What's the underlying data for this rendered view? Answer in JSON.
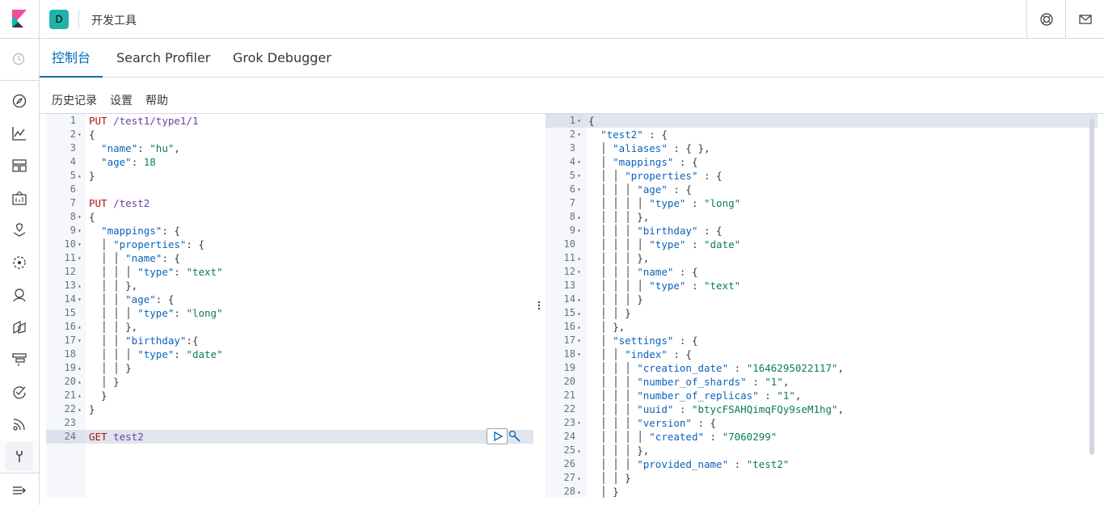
{
  "header": {
    "space_initial": "D",
    "app_title": "开发工具"
  },
  "tabs": [
    {
      "label": "控制台"
    },
    {
      "label": "Search Profiler"
    },
    {
      "label": "Grok Debugger"
    }
  ],
  "toolbar": {
    "history": "历史记录",
    "settings": "设置",
    "help": "帮助"
  },
  "request_editor": {
    "lines": [
      {
        "n": "1",
        "fold": "",
        "tokens": [
          [
            "k",
            "PUT"
          ],
          [
            "o",
            " "
          ],
          [
            "p",
            "/test1/type1/1"
          ]
        ]
      },
      {
        "n": "2",
        "fold": "▾",
        "tokens": [
          [
            "o",
            "{"
          ]
        ]
      },
      {
        "n": "3",
        "fold": "",
        "tokens": [
          [
            "o",
            "  "
          ],
          [
            "kk",
            "\"name\""
          ],
          [
            "o",
            ": "
          ],
          [
            "s",
            "\"hu\""
          ],
          [
            "o",
            ","
          ]
        ]
      },
      {
        "n": "4",
        "fold": "",
        "tokens": [
          [
            "o",
            "  "
          ],
          [
            "kk",
            "\"age\""
          ],
          [
            "o",
            ": "
          ],
          [
            "n",
            "18"
          ]
        ]
      },
      {
        "n": "5",
        "fold": "▴",
        "tokens": [
          [
            "o",
            "}"
          ]
        ]
      },
      {
        "n": "6",
        "fold": "",
        "tokens": []
      },
      {
        "n": "7",
        "fold": "",
        "tokens": [
          [
            "k",
            "PUT"
          ],
          [
            "o",
            " "
          ],
          [
            "p",
            "/test2"
          ]
        ]
      },
      {
        "n": "8",
        "fold": "▾",
        "tokens": [
          [
            "o",
            "{"
          ]
        ]
      },
      {
        "n": "9",
        "fold": "▾",
        "tokens": [
          [
            "o",
            "  "
          ],
          [
            "kk",
            "\"mappings\""
          ],
          [
            "o",
            ": {"
          ]
        ]
      },
      {
        "n": "10",
        "fold": "▾",
        "tokens": [
          [
            "o",
            "  │ "
          ],
          [
            "kk",
            "\"properties\""
          ],
          [
            "o",
            ": {"
          ]
        ]
      },
      {
        "n": "11",
        "fold": "▾",
        "tokens": [
          [
            "o",
            "  │ │ "
          ],
          [
            "kk",
            "\"name\""
          ],
          [
            "o",
            ": {"
          ]
        ]
      },
      {
        "n": "12",
        "fold": "",
        "tokens": [
          [
            "o",
            "  │ │ │ "
          ],
          [
            "kk",
            "\"type\""
          ],
          [
            "o",
            ": "
          ],
          [
            "s",
            "\"text\""
          ]
        ]
      },
      {
        "n": "13",
        "fold": "▴",
        "tokens": [
          [
            "o",
            "  │ │ },"
          ]
        ]
      },
      {
        "n": "14",
        "fold": "▾",
        "tokens": [
          [
            "o",
            "  │ │ "
          ],
          [
            "kk",
            "\"age\""
          ],
          [
            "o",
            ": {"
          ]
        ]
      },
      {
        "n": "15",
        "fold": "",
        "tokens": [
          [
            "o",
            "  │ │ │ "
          ],
          [
            "kk",
            "\"type\""
          ],
          [
            "o",
            ": "
          ],
          [
            "s",
            "\"long\""
          ]
        ]
      },
      {
        "n": "16",
        "fold": "▴",
        "tokens": [
          [
            "o",
            "  │ │ },"
          ]
        ]
      },
      {
        "n": "17",
        "fold": "▾",
        "tokens": [
          [
            "o",
            "  │ │ "
          ],
          [
            "kk",
            "\"birthday\""
          ],
          [
            "o",
            ":{"
          ]
        ]
      },
      {
        "n": "18",
        "fold": "",
        "tokens": [
          [
            "o",
            "  │ │ │ "
          ],
          [
            "kk",
            "\"type\""
          ],
          [
            "o",
            ": "
          ],
          [
            "s",
            "\"date\""
          ]
        ]
      },
      {
        "n": "19",
        "fold": "▴",
        "tokens": [
          [
            "o",
            "  │ │ }"
          ]
        ]
      },
      {
        "n": "20",
        "fold": "▴",
        "tokens": [
          [
            "o",
            "  │ }"
          ]
        ]
      },
      {
        "n": "21",
        "fold": "▴",
        "tokens": [
          [
            "o",
            "  }"
          ]
        ]
      },
      {
        "n": "22",
        "fold": "▴",
        "tokens": [
          [
            "o",
            "}"
          ]
        ]
      },
      {
        "n": "23",
        "fold": "",
        "tokens": []
      },
      {
        "n": "24",
        "fold": "",
        "tokens": [
          [
            "k",
            "GET"
          ],
          [
            "o",
            " "
          ],
          [
            "p",
            "test2"
          ]
        ],
        "highlight": true
      }
    ]
  },
  "response_editor": {
    "lines": [
      {
        "n": "1",
        "fold": "▾",
        "tokens": [
          [
            "o",
            "{"
          ]
        ],
        "highlight": true
      },
      {
        "n": "2",
        "fold": "▾",
        "tokens": [
          [
            "o",
            "  "
          ],
          [
            "kk",
            "\"test2\""
          ],
          [
            "o",
            " : {"
          ]
        ]
      },
      {
        "n": "3",
        "fold": "",
        "tokens": [
          [
            "o",
            "  │ "
          ],
          [
            "kk",
            "\"aliases\""
          ],
          [
            "o",
            " : { },"
          ]
        ]
      },
      {
        "n": "4",
        "fold": "▾",
        "tokens": [
          [
            "o",
            "  │ "
          ],
          [
            "kk",
            "\"mappings\""
          ],
          [
            "o",
            " : {"
          ]
        ]
      },
      {
        "n": "5",
        "fold": "▾",
        "tokens": [
          [
            "o",
            "  │ │ "
          ],
          [
            "kk",
            "\"properties\""
          ],
          [
            "o",
            " : {"
          ]
        ]
      },
      {
        "n": "6",
        "fold": "▾",
        "tokens": [
          [
            "o",
            "  │ │ │ "
          ],
          [
            "kk",
            "\"age\""
          ],
          [
            "o",
            " : {"
          ]
        ]
      },
      {
        "n": "7",
        "fold": "",
        "tokens": [
          [
            "o",
            "  │ │ │ │ "
          ],
          [
            "kk",
            "\"type\""
          ],
          [
            "o",
            " : "
          ],
          [
            "s",
            "\"long\""
          ]
        ]
      },
      {
        "n": "8",
        "fold": "▴",
        "tokens": [
          [
            "o",
            "  │ │ │ },"
          ]
        ]
      },
      {
        "n": "9",
        "fold": "▾",
        "tokens": [
          [
            "o",
            "  │ │ │ "
          ],
          [
            "kk",
            "\"birthday\""
          ],
          [
            "o",
            " : {"
          ]
        ]
      },
      {
        "n": "10",
        "fold": "",
        "tokens": [
          [
            "o",
            "  │ │ │ │ "
          ],
          [
            "kk",
            "\"type\""
          ],
          [
            "o",
            " : "
          ],
          [
            "s",
            "\"date\""
          ]
        ]
      },
      {
        "n": "11",
        "fold": "▴",
        "tokens": [
          [
            "o",
            "  │ │ │ },"
          ]
        ]
      },
      {
        "n": "12",
        "fold": "▾",
        "tokens": [
          [
            "o",
            "  │ │ │ "
          ],
          [
            "kk",
            "\"name\""
          ],
          [
            "o",
            " : {"
          ]
        ]
      },
      {
        "n": "13",
        "fold": "",
        "tokens": [
          [
            "o",
            "  │ │ │ │ "
          ],
          [
            "kk",
            "\"type\""
          ],
          [
            "o",
            " : "
          ],
          [
            "s",
            "\"text\""
          ]
        ]
      },
      {
        "n": "14",
        "fold": "▴",
        "tokens": [
          [
            "o",
            "  │ │ │ }"
          ]
        ]
      },
      {
        "n": "15",
        "fold": "▴",
        "tokens": [
          [
            "o",
            "  │ │ }"
          ]
        ]
      },
      {
        "n": "16",
        "fold": "▴",
        "tokens": [
          [
            "o",
            "  │ },"
          ]
        ]
      },
      {
        "n": "17",
        "fold": "▾",
        "tokens": [
          [
            "o",
            "  │ "
          ],
          [
            "kk",
            "\"settings\""
          ],
          [
            "o",
            " : {"
          ]
        ]
      },
      {
        "n": "18",
        "fold": "▾",
        "tokens": [
          [
            "o",
            "  │ │ "
          ],
          [
            "kk",
            "\"index\""
          ],
          [
            "o",
            " : {"
          ]
        ]
      },
      {
        "n": "19",
        "fold": "",
        "tokens": [
          [
            "o",
            "  │ │ │ "
          ],
          [
            "kk",
            "\"creation_date\""
          ],
          [
            "o",
            " : "
          ],
          [
            "s",
            "\"1646295022117\""
          ],
          [
            "o",
            ","
          ]
        ]
      },
      {
        "n": "20",
        "fold": "",
        "tokens": [
          [
            "o",
            "  │ │ │ "
          ],
          [
            "kk",
            "\"number_of_shards\""
          ],
          [
            "o",
            " : "
          ],
          [
            "s",
            "\"1\""
          ],
          [
            "o",
            ","
          ]
        ]
      },
      {
        "n": "21",
        "fold": "",
        "tokens": [
          [
            "o",
            "  │ │ │ "
          ],
          [
            "kk",
            "\"number_of_replicas\""
          ],
          [
            "o",
            " : "
          ],
          [
            "s",
            "\"1\""
          ],
          [
            "o",
            ","
          ]
        ]
      },
      {
        "n": "22",
        "fold": "",
        "tokens": [
          [
            "o",
            "  │ │ │ "
          ],
          [
            "kk",
            "\"uuid\""
          ],
          [
            "o",
            " : "
          ],
          [
            "s",
            "\"btycFSAHQimqFQy9seM1hg\""
          ],
          [
            "o",
            ","
          ]
        ]
      },
      {
        "n": "23",
        "fold": "▾",
        "tokens": [
          [
            "o",
            "  │ │ │ "
          ],
          [
            "kk",
            "\"version\""
          ],
          [
            "o",
            " : {"
          ]
        ]
      },
      {
        "n": "24",
        "fold": "",
        "tokens": [
          [
            "o",
            "  │ │ │ │ "
          ],
          [
            "kk",
            "\"created\""
          ],
          [
            "o",
            " : "
          ],
          [
            "s",
            "\"7060299\""
          ]
        ]
      },
      {
        "n": "25",
        "fold": "▴",
        "tokens": [
          [
            "o",
            "  │ │ │ },"
          ]
        ]
      },
      {
        "n": "26",
        "fold": "",
        "tokens": [
          [
            "o",
            "  │ │ │ "
          ],
          [
            "kk",
            "\"provided_name\""
          ],
          [
            "o",
            " : "
          ],
          [
            "s",
            "\"test2\""
          ]
        ]
      },
      {
        "n": "27",
        "fold": "▴",
        "tokens": [
          [
            "o",
            "  │ │ }"
          ]
        ]
      },
      {
        "n": "28",
        "fold": "▴",
        "tokens": [
          [
            "o",
            "  │ }"
          ]
        ]
      }
    ]
  },
  "colors": {
    "accent": "#006bb4",
    "method": "#a31515",
    "string": "#0b7f4b",
    "key": "#0b63ba",
    "space_badge": "#20b2aa"
  },
  "icons": {
    "logo": "kibana-logo-icon",
    "help": "help-lifebuoy-icon",
    "mail": "mail-icon"
  }
}
